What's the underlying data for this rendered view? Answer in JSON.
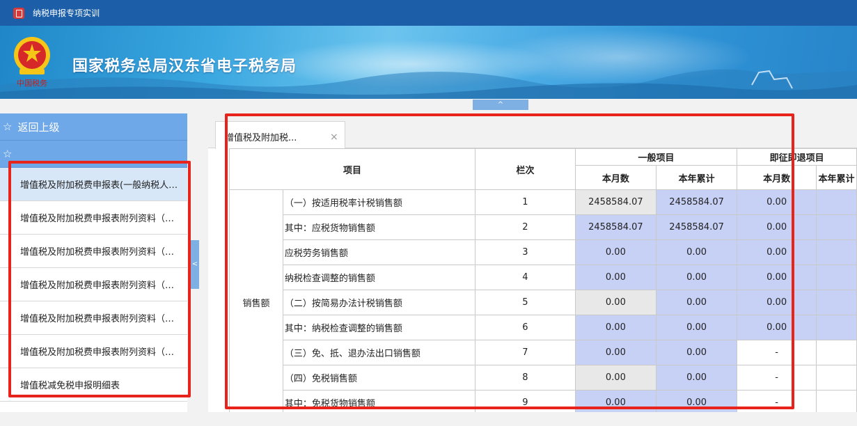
{
  "window": {
    "title": "纳税申报专项实训"
  },
  "banner": {
    "title": "国家税务总局汉东省电子税务局",
    "emblem_caption": "中国税务"
  },
  "collapse_top_symbol": "^",
  "sidebar_toggle_symbol": "<",
  "sidebar": {
    "back_label": "返回上级",
    "second_label": "",
    "items": [
      {
        "label": "增值税及附加税费申报表(一般纳税人适用)",
        "active": true
      },
      {
        "label": "增值税及附加税费申报表附列资料（一）"
      },
      {
        "label": "增值税及附加税费申报表附列资料（二）"
      },
      {
        "label": "增值税及附加税费申报表附列资料（三）"
      },
      {
        "label": "增值税及附加税费申报表附列资料（四）"
      },
      {
        "label": "增值税及附加税费申报表附列资料（五）"
      },
      {
        "label": "增值税减免税申报明细表"
      }
    ]
  },
  "tabs": [
    {
      "label": "增值税及附加税...",
      "close": "×"
    }
  ],
  "table": {
    "headers": {
      "item": "项目",
      "column_no": "栏次",
      "group_general": "一般项目",
      "group_refund": "即征即退项目",
      "this_month": "本月数",
      "year_total": "本年累计"
    },
    "group_label": "销售额",
    "rows": [
      {
        "item": "（一）按适用税率计税销售额",
        "no": "1",
        "m1": "2458584.07",
        "y1": "2458584.07",
        "m2": "0.00",
        "y2": ""
      },
      {
        "item": "其中：应税货物销售额",
        "no": "2",
        "m1": "2458584.07",
        "y1": "2458584.07",
        "m2": "0.00",
        "y2": ""
      },
      {
        "item": "应税劳务销售额",
        "no": "3",
        "m1": "0.00",
        "y1": "0.00",
        "m2": "0.00",
        "y2": ""
      },
      {
        "item": "纳税检查调整的销售额",
        "no": "4",
        "m1": "0.00",
        "y1": "0.00",
        "m2": "0.00",
        "y2": ""
      },
      {
        "item": "（二）按简易办法计税销售额",
        "no": "5",
        "m1": "0.00",
        "y1": "0.00",
        "m2": "0.00",
        "y2": ""
      },
      {
        "item": "其中：纳税检查调整的销售额",
        "no": "6",
        "m1": "0.00",
        "y1": "0.00",
        "m2": "0.00",
        "y2": ""
      },
      {
        "item": "（三）免、抵、退办法出口销售额",
        "no": "7",
        "m1": "0.00",
        "y1": "0.00",
        "m2": "-",
        "y2": ""
      },
      {
        "item": "（四）免税销售额",
        "no": "8",
        "m1": "0.00",
        "y1": "0.00",
        "m2": "-",
        "y2": ""
      },
      {
        "item": "其中：免税货物销售额",
        "no": "9",
        "m1": "0.00",
        "y1": "0.00",
        "m2": "-",
        "y2": ""
      }
    ]
  },
  "colors": {
    "highlight_box": "#e8231b",
    "editable_cell": "#c7d0f5",
    "readonly_cell": "#e8e8e8",
    "sidebar_header": "#6fa8e8"
  }
}
